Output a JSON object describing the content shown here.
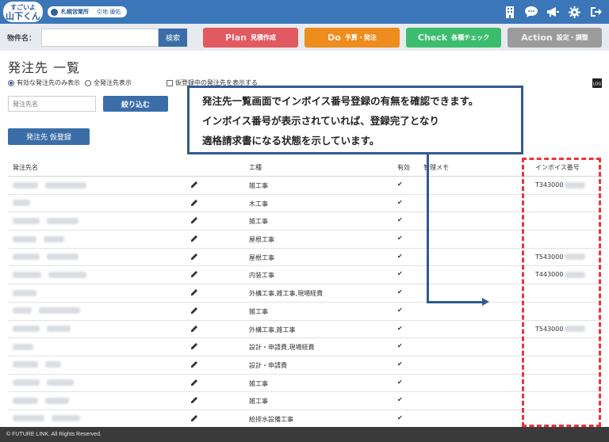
{
  "app": {
    "logo_text": "すごいよ\n山下くん",
    "office": "札幌営業所",
    "user": "引地 優佑"
  },
  "header_icons": [
    "building-icon",
    "chat-icon",
    "megaphone-icon",
    "gear-icon",
    "logout-icon"
  ],
  "search": {
    "label": "物件名：",
    "value": "",
    "button": "検索"
  },
  "phases": [
    {
      "en": "Plan",
      "jp": "見積作成",
      "color": "#e05a5f"
    },
    {
      "en": "Do",
      "jp": "予算・発注",
      "color": "#ee8c1e"
    },
    {
      "en": "Check",
      "jp": "各種チェック",
      "color": "#3cbd6d"
    },
    {
      "en": "Action",
      "jp": "設定・調整",
      "color": "#9b9b9b"
    }
  ],
  "page": {
    "title": "発注先 一覧",
    "radio_active": "有効な発注先のみ表示",
    "radio_all": "全発注先表示",
    "checkbox_label": "仮登録中の発注先を表示する",
    "name_placeholder": "発注先名",
    "filter_button": "絞り込む",
    "register_button": "発注先 仮登録",
    "log_label": "LOG"
  },
  "callout": {
    "line1": "発注先一覧画面でインボイス番号登録の有無を確認できます。",
    "line2": "インボイス番号が表示されていれば、登録完了となり",
    "line3": "適格請求書になる状態を示しています。"
  },
  "table": {
    "headers": {
      "name": "発注先名",
      "trade": "工種",
      "valid": "有効",
      "memo": "管理メモ",
      "invoice": "インボイス番号"
    },
    "rows": [
      {
        "trade": "雑工事",
        "valid": "✔",
        "invoice": "T343000"
      },
      {
        "trade": "木工事",
        "valid": "✔",
        "invoice": ""
      },
      {
        "trade": "雑工事",
        "valid": "✔",
        "invoice": ""
      },
      {
        "trade": "屋根工事",
        "valid": "✔",
        "invoice": ""
      },
      {
        "trade": "屋根工事",
        "valid": "✔",
        "invoice": "T543000"
      },
      {
        "trade": "内装工事",
        "valid": "✔",
        "invoice": "T443000"
      },
      {
        "trade": "外構工事,雑工事,現場経費",
        "valid": "✔",
        "invoice": ""
      },
      {
        "trade": "雑工事",
        "valid": "✔",
        "invoice": ""
      },
      {
        "trade": "外構工事,雑工事",
        "valid": "✔",
        "invoice": "T543000"
      },
      {
        "trade": "設計・申請費,現場経費",
        "valid": "✔",
        "invoice": ""
      },
      {
        "trade": "設計・申請費",
        "valid": "✔",
        "invoice": ""
      },
      {
        "trade": "雑工事",
        "valid": "✔",
        "invoice": ""
      },
      {
        "trade": "雑工事",
        "valid": "✔",
        "invoice": ""
      },
      {
        "trade": "給排水設備工事",
        "valid": "✔",
        "invoice": ""
      }
    ]
  },
  "footer": {
    "copyright": "© FUTURE LINK. All Rights Reserved."
  }
}
